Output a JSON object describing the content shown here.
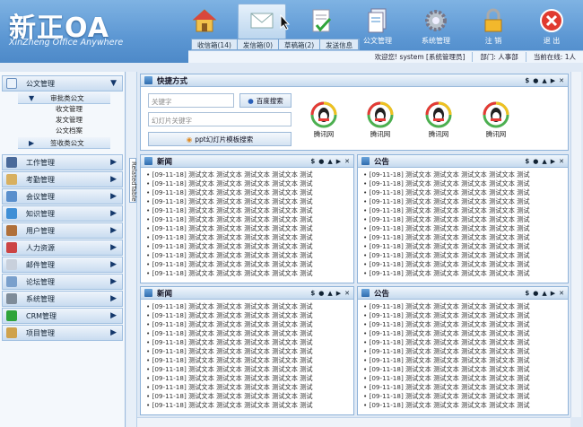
{
  "header": {
    "logo": "新正OA",
    "logo_sub": "XinZheng Office Anywhere",
    "icons": [
      {
        "name": "home-icon",
        "label": ""
      },
      {
        "name": "mail-icon",
        "label": ""
      },
      {
        "name": "document-check-icon",
        "label": ""
      },
      {
        "name": "documents-icon",
        "label": "公文管理"
      },
      {
        "name": "gear-icon",
        "label": "系统管理"
      },
      {
        "name": "lock-icon",
        "label": "注 销"
      },
      {
        "name": "exit-icon",
        "label": "退 出"
      }
    ],
    "mail_tabs": [
      "收信箱(14)",
      "发信箱(0)",
      "草稿箱(2)",
      "发送信息"
    ],
    "info": {
      "welcome": "欢迎您! system [系统管理员]",
      "dept": "部门: 人事部",
      "online": "当前在线: 1人"
    }
  },
  "sidebar": {
    "open": {
      "label": "公文管理",
      "sub_open": "审批类公文",
      "leaves": [
        "收文管理",
        "发文管理",
        "公文档案"
      ],
      "sub_closed": "签收类公文"
    },
    "items": [
      {
        "label": "工作管理",
        "icon": "monitor-icon",
        "color": "#4a6a9a"
      },
      {
        "label": "考勤管理",
        "icon": "clock-icon",
        "color": "#d8b060"
      },
      {
        "label": "会议管理",
        "icon": "meeting-icon",
        "color": "#5a8fcc"
      },
      {
        "label": "知识管理",
        "icon": "book-icon",
        "color": "#3f8fd6"
      },
      {
        "label": "用户管理",
        "icon": "user-icon",
        "color": "#b0703a"
      },
      {
        "label": "人力资源",
        "icon": "people-icon",
        "color": "#cc4444"
      },
      {
        "label": "邮件管理",
        "icon": "envelope-icon",
        "color": "#c8d0dc"
      },
      {
        "label": "论坛管理",
        "icon": "forum-icon",
        "color": "#7aa0cc"
      },
      {
        "label": "系统管理",
        "icon": "settings-icon",
        "color": "#7f8c99"
      },
      {
        "label": "CRM管理",
        "icon": "check-icon",
        "color": "#2fa43a"
      },
      {
        "label": "项目管理",
        "icon": "pen-icon",
        "color": "#cfa24c"
      }
    ]
  },
  "splitter_label": "RelatedTable",
  "quick": {
    "title": "快捷方式",
    "keyword_ph": "关键字",
    "baidu": "百度搜索",
    "ppt_ph": "幻灯片关键字",
    "ppt_btn": "ppt幻灯片模板搜索",
    "qq": [
      "腾讯网",
      "腾讯网",
      "腾讯网",
      "腾讯网"
    ]
  },
  "panels": [
    {
      "title": "新闻"
    },
    {
      "title": "公告"
    },
    {
      "title": "新闻"
    },
    {
      "title": "公告"
    }
  ],
  "list_item": "• [09-11-18] 测试文本 测试文本 测试文本 测试文本 测试",
  "tools": [
    "$",
    "●",
    "▲",
    "▶",
    "✕"
  ],
  "colors": {
    "header": "#5c97d3",
    "panel_border": "#8fb3d9"
  }
}
